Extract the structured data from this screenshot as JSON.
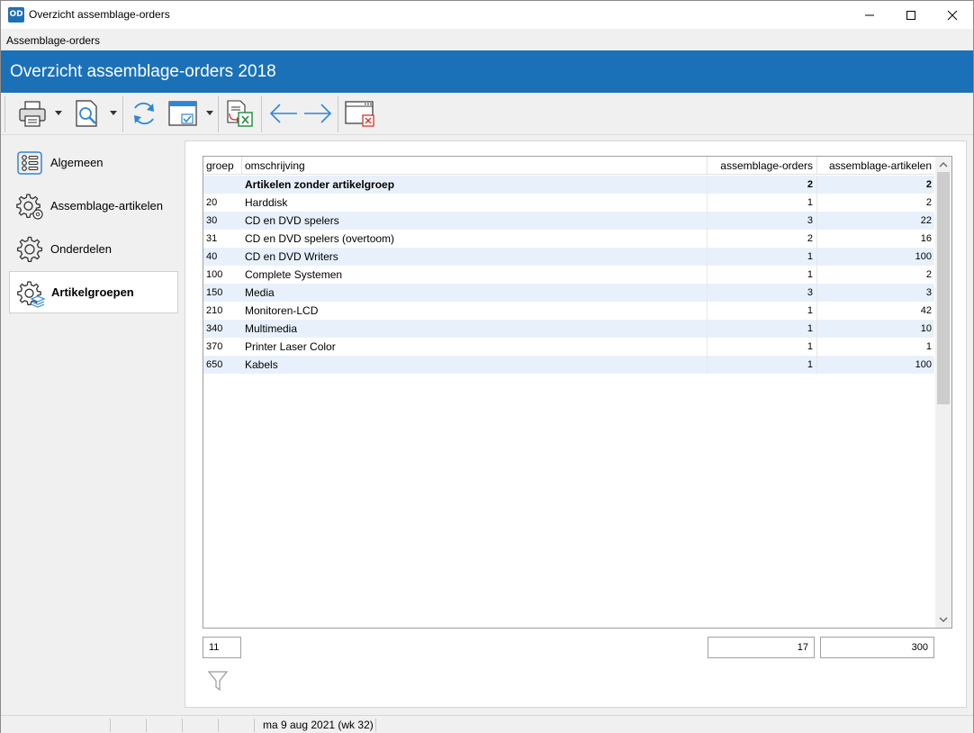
{
  "window": {
    "logo_text": "OD",
    "title": "Overzicht assemblage-orders"
  },
  "menubar": {
    "item": "Assemblage-orders"
  },
  "header": {
    "title": "Overzicht assemblage-orders 2018"
  },
  "toolbar": {
    "buttons": [
      "print-icon",
      "print-preview-icon",
      "refresh-icon",
      "select-layout-icon",
      "export-excel-icon",
      "back-arrow-icon",
      "forward-arrow-icon",
      "close-window-icon"
    ]
  },
  "sidenav": {
    "items": [
      {
        "label": "Algemeen",
        "icon": "general-icon"
      },
      {
        "label": "Assemblage-artikelen",
        "icon": "gears-icon"
      },
      {
        "label": "Onderdelen",
        "icon": "gear-icon"
      },
      {
        "label": "Artikelgroepen",
        "icon": "gear-layers-icon",
        "active": true
      }
    ]
  },
  "grid": {
    "columns": [
      "groep",
      "omschrijving",
      "assemblage-orders",
      "assemblage-artikelen"
    ],
    "rows": [
      {
        "groep": "",
        "omschrijving": "Artikelen zonder artikelgroep",
        "orders": "2",
        "artikelen": "2",
        "bold": true
      },
      {
        "groep": "20",
        "omschrijving": "Harddisk",
        "orders": "1",
        "artikelen": "2"
      },
      {
        "groep": "30",
        "omschrijving": "CD en DVD spelers",
        "orders": "3",
        "artikelen": "22"
      },
      {
        "groep": "31",
        "omschrijving": "CD en DVD spelers (overtoom)",
        "orders": "2",
        "artikelen": "16"
      },
      {
        "groep": "40",
        "omschrijving": "CD en DVD Writers",
        "orders": "1",
        "artikelen": "100"
      },
      {
        "groep": "100",
        "omschrijving": "Complete Systemen",
        "orders": "1",
        "artikelen": "2"
      },
      {
        "groep": "150",
        "omschrijving": "Media",
        "orders": "3",
        "artikelen": "3"
      },
      {
        "groep": "210",
        "omschrijving": "Monitoren-LCD",
        "orders": "1",
        "artikelen": "42"
      },
      {
        "groep": "340",
        "omschrijving": "Multimedia",
        "orders": "1",
        "artikelen": "10"
      },
      {
        "groep": "370",
        "omschrijving": "Printer Laser Color",
        "orders": "1",
        "artikelen": "1"
      },
      {
        "groep": "650",
        "omschrijving": "Kabels",
        "orders": "1",
        "artikelen": "100"
      }
    ]
  },
  "totals": {
    "count": "11",
    "orders": "17",
    "artikelen": "300"
  },
  "statusbar": {
    "date": "ma 9 aug 2021 (wk 32)"
  },
  "colors": {
    "header_blue": "#1a71b8",
    "row_alt": "#e8f1fb",
    "icon_blue": "#2f86d6"
  }
}
